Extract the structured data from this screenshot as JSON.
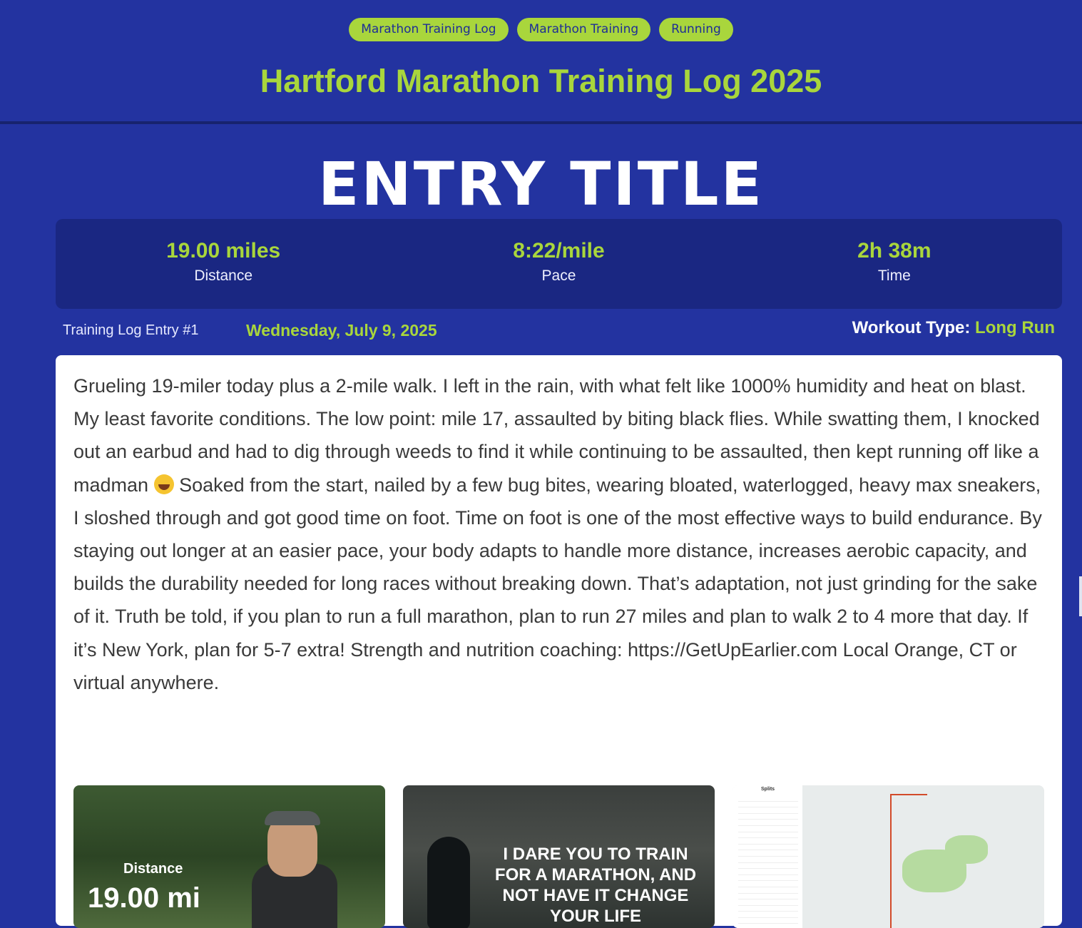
{
  "header": {
    "tags": [
      "Marathon Training Log",
      "Marathon Training",
      "Running"
    ],
    "site_title": "Hartford Marathon Training Log 2025"
  },
  "entry": {
    "title": "ENTRY TITLE",
    "stats": [
      {
        "value": "19.00 miles",
        "label": "Distance"
      },
      {
        "value": "8:22/mile",
        "label": "Pace"
      },
      {
        "value": "2h 38m",
        "label": "Time"
      }
    ],
    "entry_number": "Training Log Entry #1",
    "date": "Wednesday, July 9, 2025",
    "workout_type_label": "Workout Type:",
    "workout_type_value": "Long Run",
    "body_text_1": "Grueling 19-miler today plus a 2-mile walk. I left in the rain, with what felt like 1000% humidity and heat on blast. My least favorite conditions. The low point: mile 17, assaulted by biting black flies. While swatting them, I knocked out an earbud and had to dig through weeds to find it while continuing to be assaulted, then kept running off like a madman",
    "emoji_icon": "rolling-on-floor-laughing-emoji",
    "body_text_2": "Soaked from the start, nailed by a few bug bites, wearing bloated, waterlogged, heavy max sneakers, I sloshed through and got good time on foot. Time on foot is one of the most effective ways to build endurance. By staying out longer at an easier pace, your body adapts to handle more distance, increases aerobic capacity, and builds the durability needed for long races without breaking down. That’s adaptation, not just grinding for the sake of it. Truth be told, if you plan to run a full marathon, plan to run 27 miles and plan to walk 2 to 4 more that day. If it’s New York, plan for 5-7 extra! Strength and nutrition coaching: https://GetUpEarlier.com Local Orange, CT or virtual anywhere."
  },
  "gallery": {
    "image1": {
      "label": "Distance",
      "value": "19.00 mi"
    },
    "image2": {
      "text": "I DARE YOU TO TRAIN FOR A MARATHON, AND NOT HAVE IT CHANGE YOUR LIFE"
    },
    "image3": {
      "title": "Splits"
    }
  },
  "colors": {
    "background": "#2333a0",
    "accent": "#a9d63c",
    "panel": "#1a2782"
  }
}
